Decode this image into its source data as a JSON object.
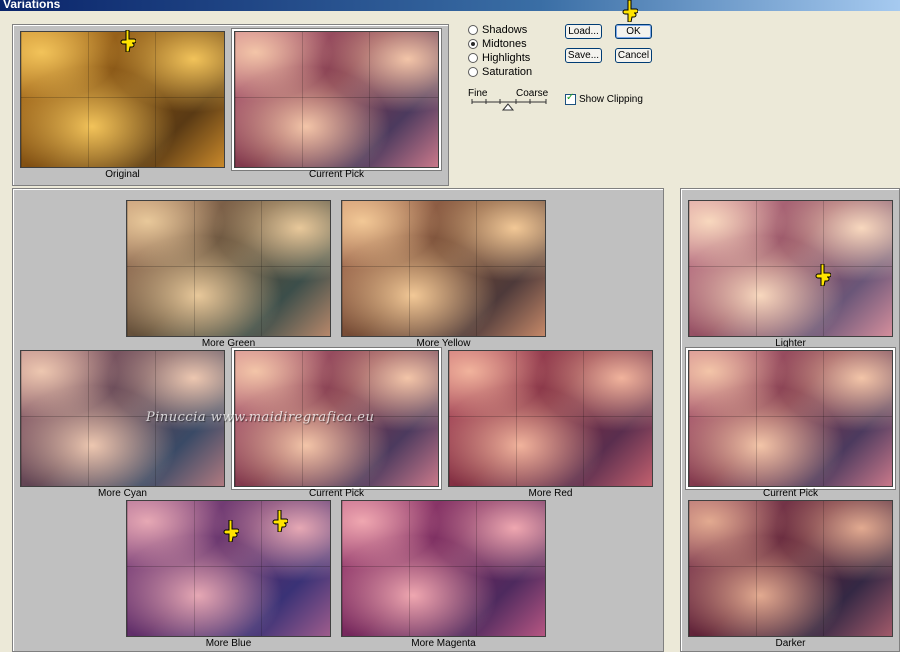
{
  "window": {
    "title": "Variations"
  },
  "modes": [
    {
      "label": "Shadows",
      "selected": false
    },
    {
      "label": "Midtones",
      "selected": true
    },
    {
      "label": "Highlights",
      "selected": false
    },
    {
      "label": "Saturation",
      "selected": false
    }
  ],
  "slider": {
    "fine_label": "Fine",
    "coarse_label": "Coarse"
  },
  "buttons": {
    "load": "Load...",
    "ok": "OK",
    "save": "Save...",
    "cancel": "Cancel"
  },
  "show_clipping": {
    "label": "Show Clipping",
    "checked": true
  },
  "top": {
    "original": "Original",
    "current_pick": "Current Pick"
  },
  "variations": {
    "more_green": "More Green",
    "more_yellow": "More Yellow",
    "more_cyan": "More Cyan",
    "current_pick": "Current Pick",
    "more_red": "More Red",
    "more_blue": "More Blue",
    "more_magenta": "More Magenta"
  },
  "brightness": {
    "lighter": "Lighter",
    "current_pick": "Current Pick",
    "darker": "Darker"
  },
  "watermark": "Pinuccia www.maidiregrafica.eu",
  "colors": {
    "original": [
      "#7A4A10",
      "#C9892B",
      "#F2C35A",
      "#5A3A14"
    ],
    "current": [
      "#7B3347",
      "#C9788A",
      "#F3C5A8",
      "#4C3A5E"
    ],
    "green": [
      "#5C4A35",
      "#B7876A",
      "#E8C89A",
      "#3C4E4A"
    ],
    "yellow": [
      "#6E4530",
      "#C58868",
      "#F2C896",
      "#4E3A3A"
    ],
    "cyan": [
      "#5A3F4F",
      "#B07A80",
      "#EDC7B0",
      "#3A4A66"
    ],
    "red": [
      "#7C2A3E",
      "#C2606E",
      "#F1B39C",
      "#5A2E4E"
    ],
    "blue": [
      "#5A2A66",
      "#9E5C8C",
      "#E6A8B4",
      "#3A3276"
    ],
    "magenta": [
      "#6E2258",
      "#B65682",
      "#EFA7B0",
      "#4E2A5E"
    ],
    "lighter": [
      "#8F4A5E",
      "#D48E9C",
      "#F8D8BE",
      "#6A5678"
    ],
    "darker": [
      "#5A1E34",
      "#A25A6A",
      "#E2AA90",
      "#342844"
    ]
  }
}
